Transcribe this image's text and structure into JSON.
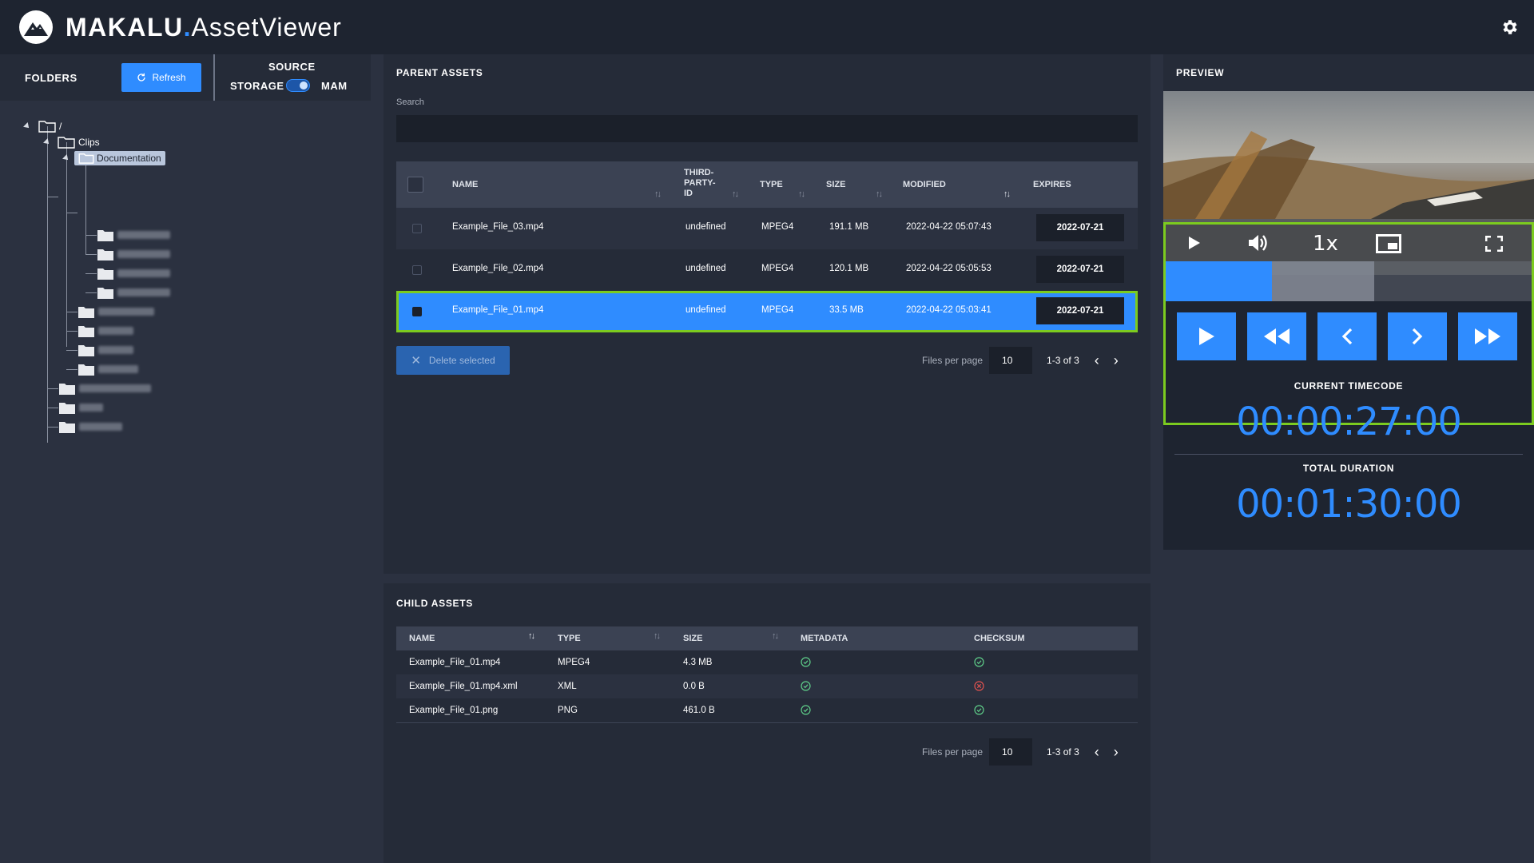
{
  "app": {
    "brand_part1": "MAKALU",
    "brand_dot": ".",
    "brand_part2": "AssetViewer"
  },
  "left": {
    "folders_label": "FOLDERS",
    "refresh_label": "Refresh",
    "source_label": "SOURCE",
    "storage_label": "STORAGE",
    "mam_label": "MAM",
    "tree": {
      "root": "/",
      "clips": "Clips",
      "documentation": "Documentation"
    }
  },
  "parent": {
    "title": "PARENT ASSETS",
    "search_label": "Search",
    "search_value": "",
    "columns": {
      "name": "NAME",
      "third_party_1": "THIRD-",
      "third_party_2": "PARTY-",
      "third_party_3": "ID",
      "type": "TYPE",
      "size": "SIZE",
      "modified": "MODIFIED",
      "expires": "EXPIRES"
    },
    "rows": [
      {
        "name": "Example_File_03.mp4",
        "third_party_id": "undefined",
        "type": "MPEG4",
        "size": "191.1 MB",
        "modified": "2022-04-22 05:07:43",
        "expires": "2022-07-21"
      },
      {
        "name": "Example_File_02.mp4",
        "third_party_id": "undefined",
        "type": "MPEG4",
        "size": "120.1 MB",
        "modified": "2022-04-22 05:05:53",
        "expires": "2022-07-21"
      },
      {
        "name": "Example_File_01.mp4",
        "third_party_id": "undefined",
        "type": "MPEG4",
        "size": "33.5 MB",
        "modified": "2022-04-22 05:03:41",
        "expires": "2022-07-21"
      }
    ],
    "selected_row": 2,
    "delete_label": "Delete selected",
    "pager": {
      "label": "Files per page",
      "per_page": "10",
      "range": "1-3 of 3"
    }
  },
  "child": {
    "title": "CHILD ASSETS",
    "columns": {
      "name": "NAME",
      "type": "TYPE",
      "size": "SIZE",
      "metadata": "METADATA",
      "checksum": "CHECKSUM"
    },
    "rows": [
      {
        "name": "Example_File_01.mp4",
        "type": "MPEG4",
        "size": "4.3 MB",
        "metadata": "ok",
        "checksum": "ok"
      },
      {
        "name": "Example_File_01.mp4.xml",
        "type": "XML",
        "size": "0.0 B",
        "metadata": "ok",
        "checksum": "error"
      },
      {
        "name": "Example_File_01.png",
        "type": "PNG",
        "size": "461.0 B",
        "metadata": "ok",
        "checksum": "ok"
      }
    ],
    "pager": {
      "label": "Files per page",
      "per_page": "10",
      "range": "1-3 of 3"
    }
  },
  "preview": {
    "title": "PREVIEW",
    "speed": "1x",
    "progress_played_fraction": 0.29,
    "progress_buffered_fraction": 0.57,
    "current_timecode_label": "CURRENT TIMECODE",
    "current_timecode": "00:00:27:00",
    "total_duration_label": "TOTAL DURATION",
    "total_duration": "00:01:30:00"
  },
  "colors": {
    "accent": "#2f8cff",
    "highlight": "#7ccb1f",
    "ok": "#5fd08a",
    "error": "#e0524f"
  }
}
